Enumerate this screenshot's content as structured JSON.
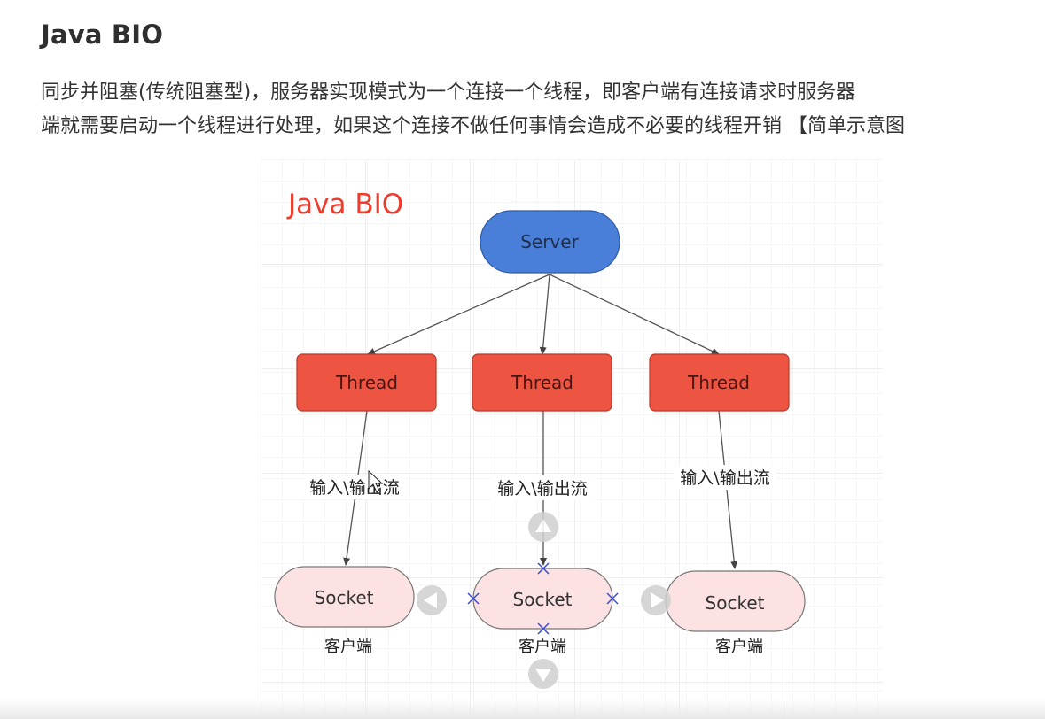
{
  "heading": "Java BIO",
  "intro": {
    "line1": "同步并阻塞(传统阻塞型)，服务器实现模式为一个连接一个线程，即客户端有连接请求时服务器",
    "line2": "端就需要启动一个线程进行处理，如果这个连接不做任何事情会造成不必要的线程开销 【简单示意图"
  },
  "diagram": {
    "title": "Java BIO",
    "server_label": "Server",
    "threads": [
      {
        "label": "Thread",
        "stream_label": "输入\\输出流"
      },
      {
        "label": "Thread",
        "stream_label": "输入\\输出流"
      },
      {
        "label": "Thread",
        "stream_label": "输入\\输出流"
      }
    ],
    "sockets": [
      {
        "label": "Socket",
        "caption": "客户端"
      },
      {
        "label": "Socket",
        "caption": "客户端"
      },
      {
        "label": "Socket",
        "caption": "客户端"
      }
    ],
    "colors": {
      "server_fill": "#4a7fd9",
      "thread_fill": "#ee5442",
      "socket_fill": "#fde2e4",
      "title_red": "#ef3b2c",
      "connector": "#444444",
      "handle_x": "#3a4bd6",
      "grid": "#e6e6e6"
    }
  }
}
